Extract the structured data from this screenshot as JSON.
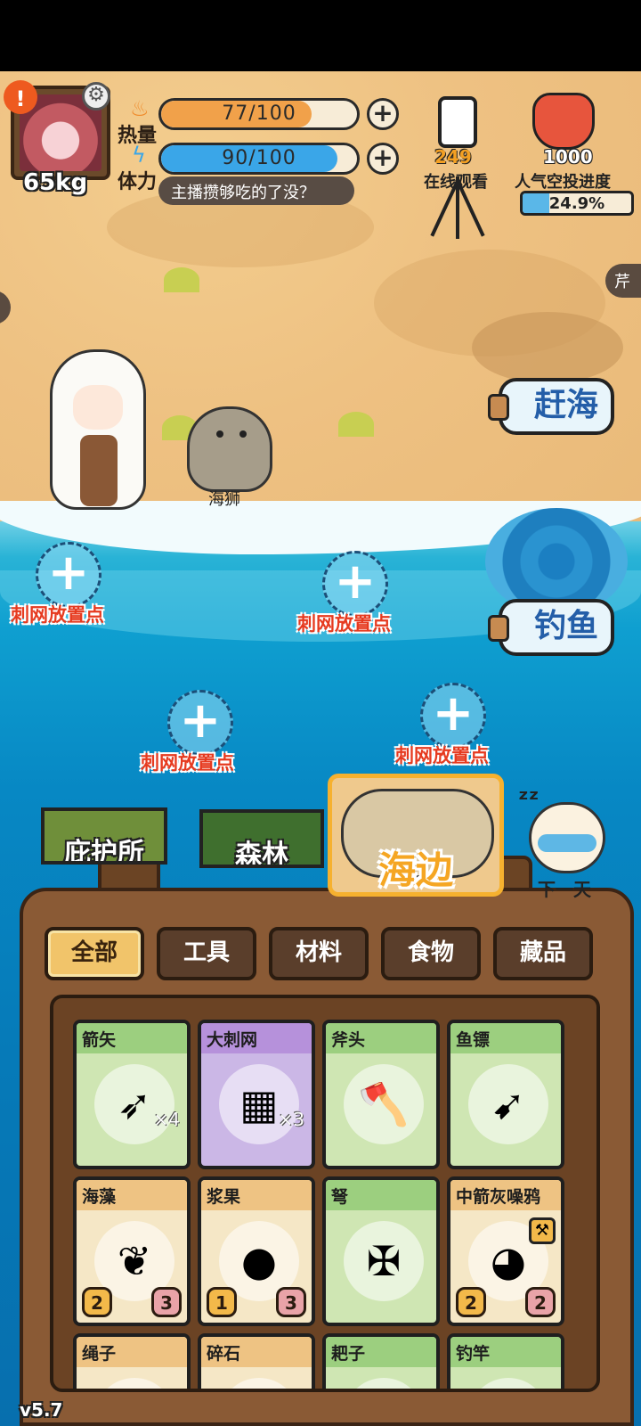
{
  "player": {
    "weight": "65kg",
    "alert_icon": "exclamation-icon",
    "settings_icon": "gear-icon"
  },
  "stats": {
    "calories": {
      "label": "热量",
      "text": "77/100",
      "value": 77,
      "max": 100,
      "color": "#f1a14a",
      "icon": "fire-icon"
    },
    "stamina": {
      "label": "体力",
      "text": "90/100",
      "value": 90,
      "max": 100,
      "color": "#3aa6e8",
      "icon": "lightning-icon"
    }
  },
  "chat_message": "主播攒够吃的了没？",
  "stream": {
    "viewers": "249",
    "viewers_label": "在线观看",
    "airdrop_count": "1000",
    "airdrop_label": "人气空投进度",
    "airdrop_progress_text": "24.9%",
    "airdrop_progress": 0.249
  },
  "side_tab": "芹",
  "scene": {
    "npc_name": "海狮",
    "actions": {
      "gather": "赶海",
      "fish": "钓鱼"
    },
    "net_spot_label": "刺网放置点"
  },
  "locations": {
    "shelter": "庇护所",
    "forest": "森林",
    "beach": "海边",
    "next_day": "下一天",
    "sleep_icon": "zzz-icon"
  },
  "categories": [
    "全部",
    "工具",
    "材料",
    "食物",
    "藏品"
  ],
  "inventory": [
    {
      "name": "箭矢",
      "icon": "arrow-icon",
      "glyph": "➶",
      "qty": "×4",
      "rarity": "green"
    },
    {
      "name": "大刺网",
      "icon": "net-icon",
      "glyph": "▦",
      "qty": "×3",
      "rarity": "purple"
    },
    {
      "name": "斧头",
      "icon": "axe-icon",
      "glyph": "🪓",
      "qty": "",
      "rarity": "green"
    },
    {
      "name": "鱼镖",
      "icon": "harpoon-icon",
      "glyph": "➹",
      "qty": "",
      "rarity": "green"
    },
    {
      "name": "海藻",
      "icon": "seaweed-icon",
      "glyph": "❦",
      "qty": "",
      "rarity": "orange",
      "badge_left": "2",
      "badge_right": "3"
    },
    {
      "name": "浆果",
      "icon": "berry-icon",
      "glyph": "●",
      "qty": "",
      "rarity": "orange",
      "badge_left": "1",
      "badge_right": "3"
    },
    {
      "name": "弩",
      "icon": "crossbow-icon",
      "glyph": "✠",
      "qty": "",
      "rarity": "green"
    },
    {
      "name": "中箭灰噪鸦",
      "icon": "bird-icon",
      "glyph": "◕",
      "qty": "",
      "rarity": "orange",
      "badge_left": "2",
      "badge_right": "2",
      "tag": "shovel-icon"
    },
    {
      "name": "绳子",
      "icon": "rope-icon",
      "glyph": "",
      "qty": "",
      "rarity": "orange"
    },
    {
      "name": "碎石",
      "icon": "rock-icon",
      "glyph": "",
      "qty": "",
      "rarity": "orange"
    },
    {
      "name": "耙子",
      "icon": "rake-icon",
      "glyph": "",
      "qty": "",
      "rarity": "green"
    },
    {
      "name": "钓竿",
      "icon": "fishing-rod-icon",
      "glyph": "",
      "qty": "",
      "rarity": "green"
    }
  ],
  "version": "v5.7"
}
